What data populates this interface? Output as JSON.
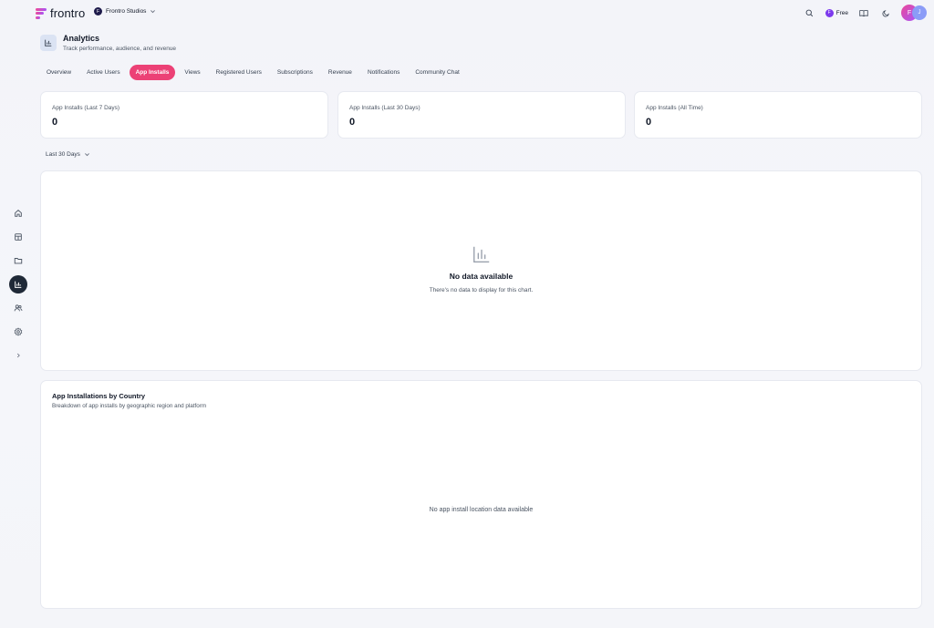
{
  "brand": {
    "name": "frontro"
  },
  "org": {
    "name": "Frontro Studios",
    "initial": "F"
  },
  "topbar": {
    "plan_label": "Free",
    "plan_initial": "F",
    "user_initial": "F",
    "user2_initial": "J"
  },
  "header": {
    "title": "Analytics",
    "subtitle": "Track performance, audience, and revenue"
  },
  "tabs": [
    {
      "label": "Overview"
    },
    {
      "label": "Active Users"
    },
    {
      "label": "App Installs"
    },
    {
      "label": "Views"
    },
    {
      "label": "Registered Users"
    },
    {
      "label": "Subscriptions"
    },
    {
      "label": "Revenue"
    },
    {
      "label": "Notifications"
    },
    {
      "label": "Community Chat"
    }
  ],
  "active_tab": "App Installs",
  "stats": [
    {
      "label": "App Installs (Last 7 Days)",
      "value": "0"
    },
    {
      "label": "App Installs (Last 30 Days)",
      "value": "0"
    },
    {
      "label": "App Installs (All Time)",
      "value": "0"
    }
  ],
  "range": {
    "selected": "Last 30 Days"
  },
  "chart_empty": {
    "title": "No data available",
    "subtitle": "There's no data to display for this chart."
  },
  "country_section": {
    "title": "App Installations by Country",
    "subtitle": "Breakdown of app installs by geographic region and platform",
    "empty": "No app install location data available"
  },
  "colors": {
    "accent": "#ec4176",
    "sidebar_active": "#1f2937"
  },
  "sidebar_icons": [
    "home-icon",
    "layout-icon",
    "folder-icon",
    "analytics-icon",
    "users-icon",
    "settings-icon",
    "expand-icon"
  ]
}
